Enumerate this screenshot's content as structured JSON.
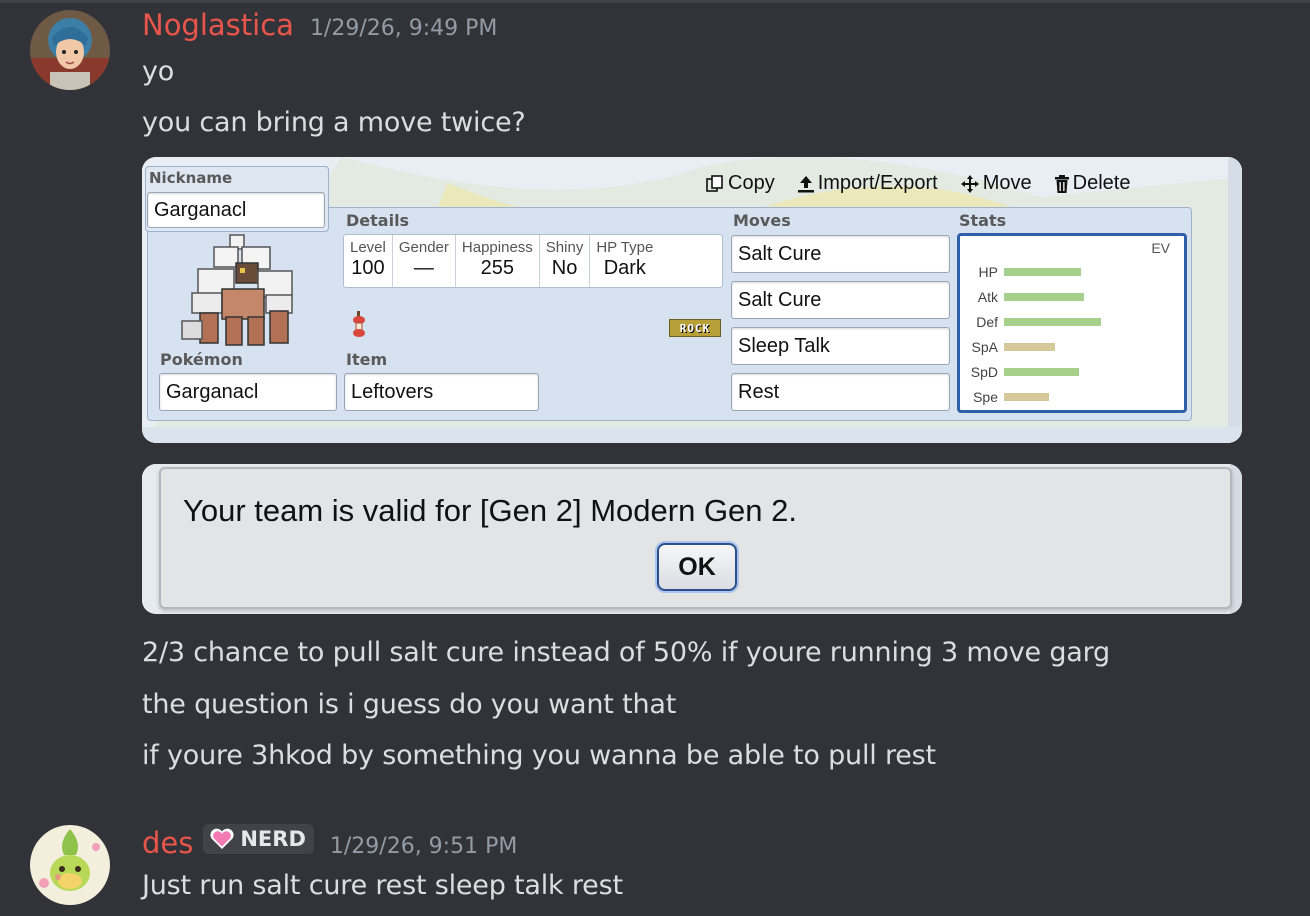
{
  "messages": [
    {
      "author": "Noglastica",
      "timestamp": "1/29/26, 9:49 PM",
      "lines": [
        "yo",
        "you can bring a move twice?"
      ],
      "after_lines": [
        "2/3 chance to pull salt cure instead of 50% if youre running 3 move garg",
        "the question is i guess do you want that",
        "if youre 3hkod by something you wanna be able to pull rest"
      ]
    },
    {
      "author": "des",
      "badge": "NERD",
      "timestamp": "1/29/26, 9:51 PM",
      "lines": [
        "Just run salt cure rest sleep talk rest"
      ]
    }
  ],
  "teambuilder": {
    "nickname_label": "Nickname",
    "nickname": "Garganacl",
    "toolbar": {
      "copy": "Copy",
      "import_export": "Import/Export",
      "move": "Move",
      "delete": "Delete"
    },
    "details_label": "Details",
    "details": {
      "level_label": "Level",
      "level": "100",
      "gender_label": "Gender",
      "gender": "—",
      "happiness_label": "Happiness",
      "happiness": "255",
      "shiny_label": "Shiny",
      "shiny": "No",
      "hptype_label": "HP Type",
      "hptype": "Dark"
    },
    "type_tag": "ROCK",
    "pokemon_label": "Pokémon",
    "pokemon": "Garganacl",
    "item_label": "Item",
    "item": "Leftovers",
    "moves_label": "Moves",
    "moves": [
      "Salt Cure",
      "Salt Cure",
      "Sleep Talk",
      "Rest"
    ],
    "stats_label": "Stats",
    "ev_label": "EV",
    "stats": [
      {
        "name": "HP",
        "level": 0.7,
        "color": "#a8d08d"
      },
      {
        "name": "Atk",
        "level": 0.73,
        "color": "#a8d08d"
      },
      {
        "name": "Def",
        "level": 0.88,
        "color": "#a8d08d"
      },
      {
        "name": "SpA",
        "level": 0.46,
        "color": "#d5c89a"
      },
      {
        "name": "SpD",
        "level": 0.68,
        "color": "#a8d08d"
      },
      {
        "name": "Spe",
        "level": 0.41,
        "color": "#d5c89a"
      }
    ]
  },
  "validation": {
    "message": "Your team is valid for [Gen 2] Modern Gen 2.",
    "ok": "OK"
  }
}
